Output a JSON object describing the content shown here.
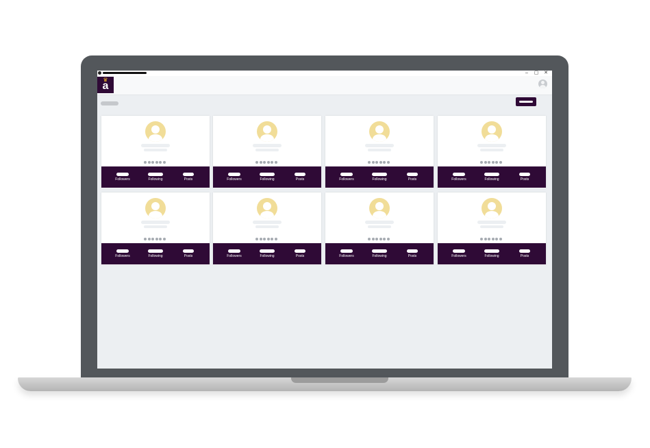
{
  "app": {
    "logo_letter": "a",
    "logo_crown": "♛",
    "window_controls": [
      "–",
      "▢",
      "✕"
    ]
  },
  "colors": {
    "brand": "#2f0a36",
    "avatar_placeholder": "#f1dd98",
    "page_background": "#eceff2"
  },
  "cards": [
    {
      "stats": [
        {
          "label": "Followers"
        },
        {
          "label": "Following"
        },
        {
          "label": "Posts"
        }
      ]
    },
    {
      "stats": [
        {
          "label": "Followers"
        },
        {
          "label": "Following"
        },
        {
          "label": "Posts"
        }
      ]
    },
    {
      "stats": [
        {
          "label": "Followers"
        },
        {
          "label": "Following"
        },
        {
          "label": "Posts"
        }
      ]
    },
    {
      "stats": [
        {
          "label": "Followers"
        },
        {
          "label": "Following"
        },
        {
          "label": "Posts"
        }
      ]
    },
    {
      "stats": [
        {
          "label": "Followers"
        },
        {
          "label": "Following"
        },
        {
          "label": "Posts"
        }
      ]
    },
    {
      "stats": [
        {
          "label": "Followers"
        },
        {
          "label": "Following"
        },
        {
          "label": "Posts"
        }
      ]
    },
    {
      "stats": [
        {
          "label": "Followers"
        },
        {
          "label": "Following"
        },
        {
          "label": "Posts"
        }
      ]
    },
    {
      "stats": [
        {
          "label": "Followers"
        },
        {
          "label": "Following"
        },
        {
          "label": "Posts"
        }
      ]
    }
  ]
}
